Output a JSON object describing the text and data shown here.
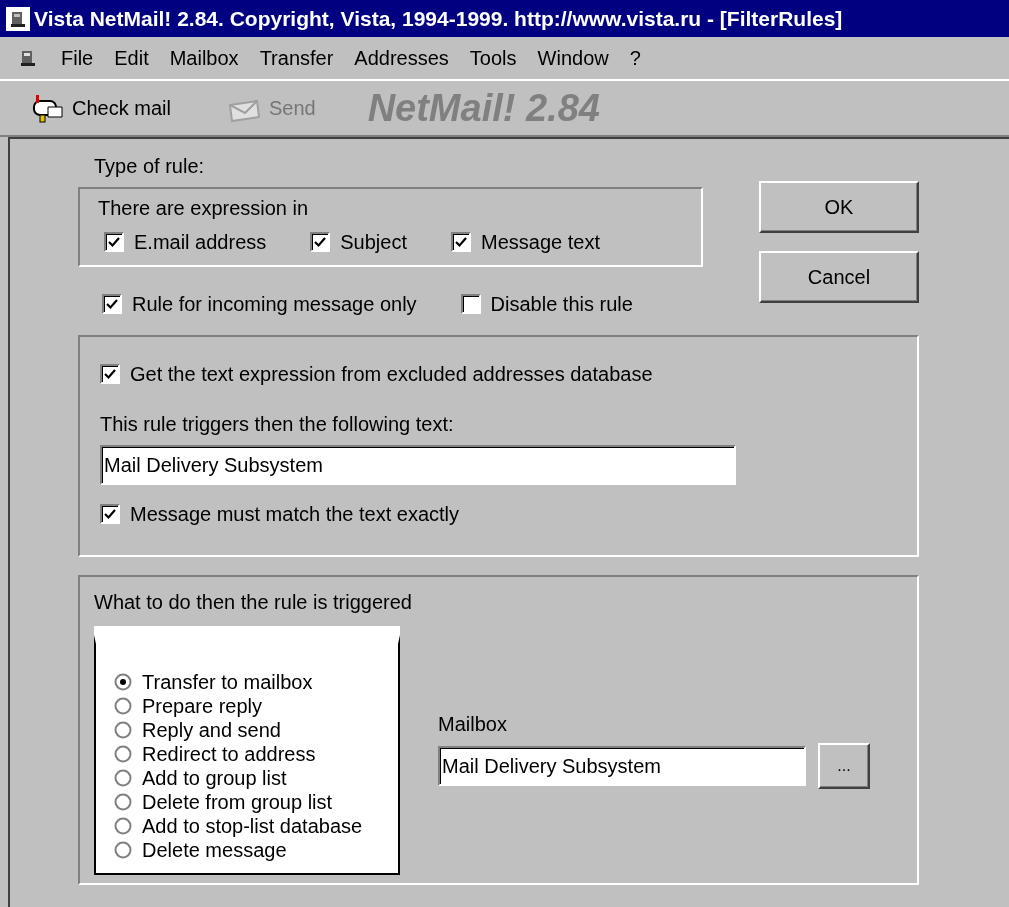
{
  "window": {
    "title": "Vista NetMail! 2.84. Copyright, Vista, 1994-1999. http://www.vista.ru  - [FilterRules]"
  },
  "menu": [
    "File",
    "Edit",
    "Mailbox",
    "Transfer",
    "Addresses",
    "Tools",
    "Window",
    "?"
  ],
  "toolbar": {
    "buttons": [
      {
        "label": "Check mail",
        "disabled": false
      },
      {
        "label": "Send",
        "disabled": true
      }
    ],
    "brand": "NetMail! 2.84"
  },
  "type_of_rule": {
    "label": "Type of rule:",
    "group_label": "There are expression in",
    "checks": [
      {
        "label": "E.mail address",
        "checked": true
      },
      {
        "label": "Subject",
        "checked": true
      },
      {
        "label": "Message text",
        "checked": true
      }
    ],
    "options": [
      {
        "label": "Rule for incoming message only",
        "checked": true
      },
      {
        "label": "Disable this rule",
        "checked": false
      }
    ]
  },
  "buttons": [
    "OK",
    "Cancel"
  ],
  "expression": {
    "from_db": {
      "label": "Get the text expression from excluded addresses database",
      "checked": true
    },
    "text_label": "This rule triggers then the following text:",
    "text_value": "Mail Delivery Subsystem",
    "exact": {
      "label": "Message must match the text exactly",
      "checked": true
    }
  },
  "action": {
    "label": "What to do then the rule is triggered",
    "options": [
      {
        "label": "Transfer to mailbox",
        "selected": true
      },
      {
        "label": "Prepare reply",
        "selected": false
      },
      {
        "label": "Reply and send",
        "selected": false
      },
      {
        "label": "Redirect to address",
        "selected": false
      },
      {
        "label": "Add to group list",
        "selected": false
      },
      {
        "label": "Delete from group list",
        "selected": false
      },
      {
        "label": "Add to stop-list database",
        "selected": false
      },
      {
        "label": "Delete message",
        "selected": false
      }
    ],
    "mailbox_label": "Mailbox",
    "mailbox_value": "Mail Delivery Subsystem",
    "browse": "..."
  }
}
